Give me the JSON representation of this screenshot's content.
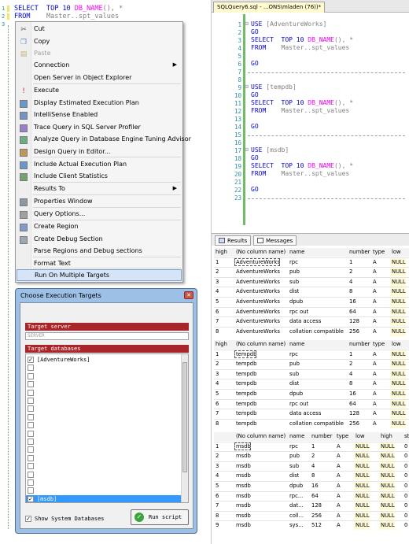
{
  "left_editor": {
    "lines": [
      {
        "num": "1",
        "text_kw1": "SELECT",
        "text_mid": "  TOP 10 ",
        "text_fn": "DB_NAME",
        "text_rest": "(), *"
      },
      {
        "num": "2",
        "text_kw1": "FROM",
        "text_mid": "    Master..spt_values",
        "text_fn": "",
        "text_rest": ""
      },
      {
        "num": "3",
        "text_kw1": "",
        "text_mid": "",
        "text_fn": "",
        "text_rest": ""
      }
    ]
  },
  "context_menu": {
    "items": [
      {
        "label": "Cut",
        "icon": "scissors-icon",
        "disabled": false
      },
      {
        "label": "Copy",
        "icon": "copy-icon",
        "disabled": false
      },
      {
        "label": "Paste",
        "icon": "paste-icon",
        "disabled": true
      },
      {
        "label": "Connection",
        "icon": "",
        "disabled": false,
        "submenu": true
      },
      {
        "label": "Open Server in Object Explorer",
        "icon": "",
        "disabled": false
      },
      {
        "label": "Execute",
        "icon": "execute-icon",
        "disabled": false
      },
      {
        "label": "Display Estimated Execution Plan",
        "icon": "plan-icon",
        "disabled": false
      },
      {
        "label": "IntelliSense Enabled",
        "icon": "intellisense-icon",
        "disabled": false
      },
      {
        "label": "Trace Query in SQL Server Profiler",
        "icon": "profiler-icon",
        "disabled": false
      },
      {
        "label": "Analyze Query in Database Engine Tuning Advisor",
        "icon": "tuning-icon",
        "disabled": false
      },
      {
        "label": "Design Query in Editor...",
        "icon": "design-icon",
        "disabled": false
      },
      {
        "label": "Include Actual Execution Plan",
        "icon": "actual-plan-icon",
        "disabled": false
      },
      {
        "label": "Include Client Statistics",
        "icon": "statistics-icon",
        "disabled": false
      },
      {
        "label": "Results To",
        "icon": "",
        "disabled": false,
        "submenu": true
      },
      {
        "label": "Properties Window",
        "icon": "properties-icon",
        "disabled": false
      },
      {
        "label": "Query Options...",
        "icon": "options-icon",
        "disabled": false
      },
      {
        "label": "Create Region",
        "icon": "region-icon",
        "disabled": false
      },
      {
        "label": "Create Debug Section",
        "icon": "debug-icon",
        "disabled": false
      },
      {
        "label": "Parse Regions and Debug sections",
        "icon": "",
        "disabled": false
      },
      {
        "label": "Format Text",
        "icon": "",
        "disabled": false
      },
      {
        "label": "Run On Multiple Targets",
        "icon": "",
        "disabled": false,
        "selected": true
      }
    ]
  },
  "dialog": {
    "title": "Choose Execution Targets",
    "target_server_label": "Target server",
    "target_server_value": "SERVER",
    "target_databases_label": "Target databases",
    "databases": [
      {
        "name": "[AdventureWorks]",
        "checked": true,
        "selected": false
      },
      {
        "name": "[msdb]",
        "checked": true,
        "selected": true
      }
    ],
    "show_system_label": "Show System Databases",
    "run_label": "Run script"
  },
  "right_editor": {
    "tab_title": "SQLQuery6.sql - ...ONS\\mladen (76))*",
    "blocks": [
      {
        "db": "[AdventureWorks]"
      },
      {
        "db": "[tempdb]"
      },
      {
        "db": "[msdb]"
      }
    ],
    "go": "GO",
    "use": "USE",
    "select": "SELECT",
    "top": "TOP 10",
    "dbname_fn": "DB_NAME",
    "rest": "(), *",
    "from": "FROM",
    "table": "Master..spt_values",
    "line_numbers": [
      "1",
      "2",
      "3",
      "4",
      "5",
      "6",
      "7",
      "8",
      "9",
      "10",
      "11",
      "12",
      "13",
      "14",
      "15",
      "16",
      "17",
      "18",
      "19",
      "20",
      "21",
      "22",
      "23"
    ]
  },
  "results": {
    "tab_results": "Results",
    "tab_messages": "Messages",
    "grids": [
      {
        "columns": [
          "(No column name)",
          "name",
          "number",
          "type",
          "low",
          "high"
        ],
        "rows": [
          [
            "1",
            "AdventureWorks",
            "rpc",
            "1",
            "A",
            "NULL"
          ],
          [
            "2",
            "AdventureWorks",
            "pub",
            "2",
            "A",
            "NULL"
          ],
          [
            "3",
            "AdventureWorks",
            "sub",
            "4",
            "A",
            "NULL"
          ],
          [
            "4",
            "AdventureWorks",
            "dist",
            "8",
            "A",
            "NULL"
          ],
          [
            "5",
            "AdventureWorks",
            "dpub",
            "16",
            "A",
            "NULL"
          ],
          [
            "6",
            "AdventureWorks",
            "rpc out",
            "64",
            "A",
            "NULL"
          ],
          [
            "7",
            "AdventureWorks",
            "data access",
            "128",
            "A",
            "NULL"
          ],
          [
            "8",
            "AdventureWorks",
            "collation compatible",
            "256",
            "A",
            "NULL"
          ]
        ]
      },
      {
        "columns": [
          "(No column name)",
          "name",
          "number",
          "type",
          "low",
          "high"
        ],
        "rows": [
          [
            "1",
            "tempdb",
            "rpc",
            "1",
            "A",
            "NULL"
          ],
          [
            "2",
            "tempdb",
            "pub",
            "2",
            "A",
            "NULL"
          ],
          [
            "3",
            "tempdb",
            "sub",
            "4",
            "A",
            "NULL"
          ],
          [
            "4",
            "tempdb",
            "dist",
            "8",
            "A",
            "NULL"
          ],
          [
            "5",
            "tempdb",
            "dpub",
            "16",
            "A",
            "NULL"
          ],
          [
            "6",
            "tempdb",
            "rpc out",
            "64",
            "A",
            "NULL"
          ],
          [
            "7",
            "tempdb",
            "data access",
            "128",
            "A",
            "NULL"
          ],
          [
            "8",
            "tempdb",
            "collation compatible",
            "256",
            "A",
            "NULL"
          ]
        ]
      },
      {
        "columns": [
          "(No column name)",
          "name",
          "number",
          "type",
          "low",
          "high",
          "status"
        ],
        "rows": [
          [
            "1",
            "msdb",
            "rpc",
            "1",
            "A",
            "NULL",
            "NULL",
            "0"
          ],
          [
            "2",
            "msdb",
            "pub",
            "2",
            "A",
            "NULL",
            "NULL",
            "0"
          ],
          [
            "3",
            "msdb",
            "sub",
            "4",
            "A",
            "NULL",
            "NULL",
            "0"
          ],
          [
            "4",
            "msdb",
            "dist",
            "8",
            "A",
            "NULL",
            "NULL",
            "0"
          ],
          [
            "5",
            "msdb",
            "dpub",
            "16",
            "A",
            "NULL",
            "NULL",
            "0"
          ],
          [
            "6",
            "msdb",
            "rpc...",
            "64",
            "A",
            "NULL",
            "NULL",
            "0"
          ],
          [
            "7",
            "msdb",
            "dat...",
            "128",
            "A",
            "NULL",
            "NULL",
            "0"
          ],
          [
            "8",
            "msdb",
            "coll...",
            "256",
            "A",
            "NULL",
            "NULL",
            "0"
          ],
          [
            "9",
            "msdb",
            "sys...",
            "512",
            "A",
            "NULL",
            "NULL",
            "0"
          ]
        ]
      }
    ]
  }
}
